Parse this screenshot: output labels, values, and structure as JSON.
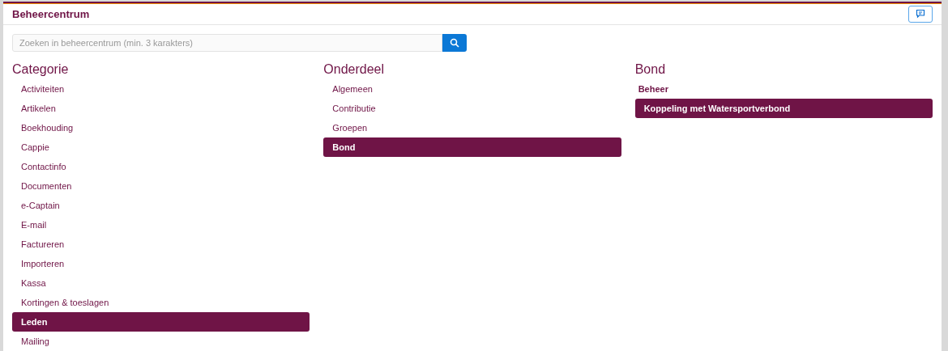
{
  "header": {
    "title": "Beheercentrum"
  },
  "search": {
    "placeholder": "Zoeken in beheercentrum (min. 3 karakters)"
  },
  "columns": [
    {
      "title": "Categorie",
      "items": [
        {
          "kind": "item",
          "label": "Activiteiten",
          "selected": false
        },
        {
          "kind": "item",
          "label": "Artikelen",
          "selected": false
        },
        {
          "kind": "item",
          "label": "Boekhouding",
          "selected": false
        },
        {
          "kind": "item",
          "label": "Cappie",
          "selected": false
        },
        {
          "kind": "item",
          "label": "Contactinfo",
          "selected": false
        },
        {
          "kind": "item",
          "label": "Documenten",
          "selected": false
        },
        {
          "kind": "item",
          "label": "e-Captain",
          "selected": false
        },
        {
          "kind": "item",
          "label": "E-mail",
          "selected": false
        },
        {
          "kind": "item",
          "label": "Factureren",
          "selected": false
        },
        {
          "kind": "item",
          "label": "Importeren",
          "selected": false
        },
        {
          "kind": "item",
          "label": "Kassa",
          "selected": false
        },
        {
          "kind": "item",
          "label": "Kortingen & toeslagen",
          "selected": false
        },
        {
          "kind": "item",
          "label": "Leden",
          "selected": true
        },
        {
          "kind": "item",
          "label": "Mailing",
          "selected": false
        }
      ]
    },
    {
      "title": "Onderdeel",
      "items": [
        {
          "kind": "item",
          "label": "Algemeen",
          "selected": false
        },
        {
          "kind": "item",
          "label": "Contributie",
          "selected": false
        },
        {
          "kind": "item",
          "label": "Groepen",
          "selected": false
        },
        {
          "kind": "item",
          "label": "Bond",
          "selected": true
        }
      ]
    },
    {
      "title": "Bond",
      "items": [
        {
          "kind": "group",
          "label": "Beheer"
        },
        {
          "kind": "item",
          "label": "Koppeling met Watersportverbond",
          "selected": true
        }
      ]
    }
  ]
}
